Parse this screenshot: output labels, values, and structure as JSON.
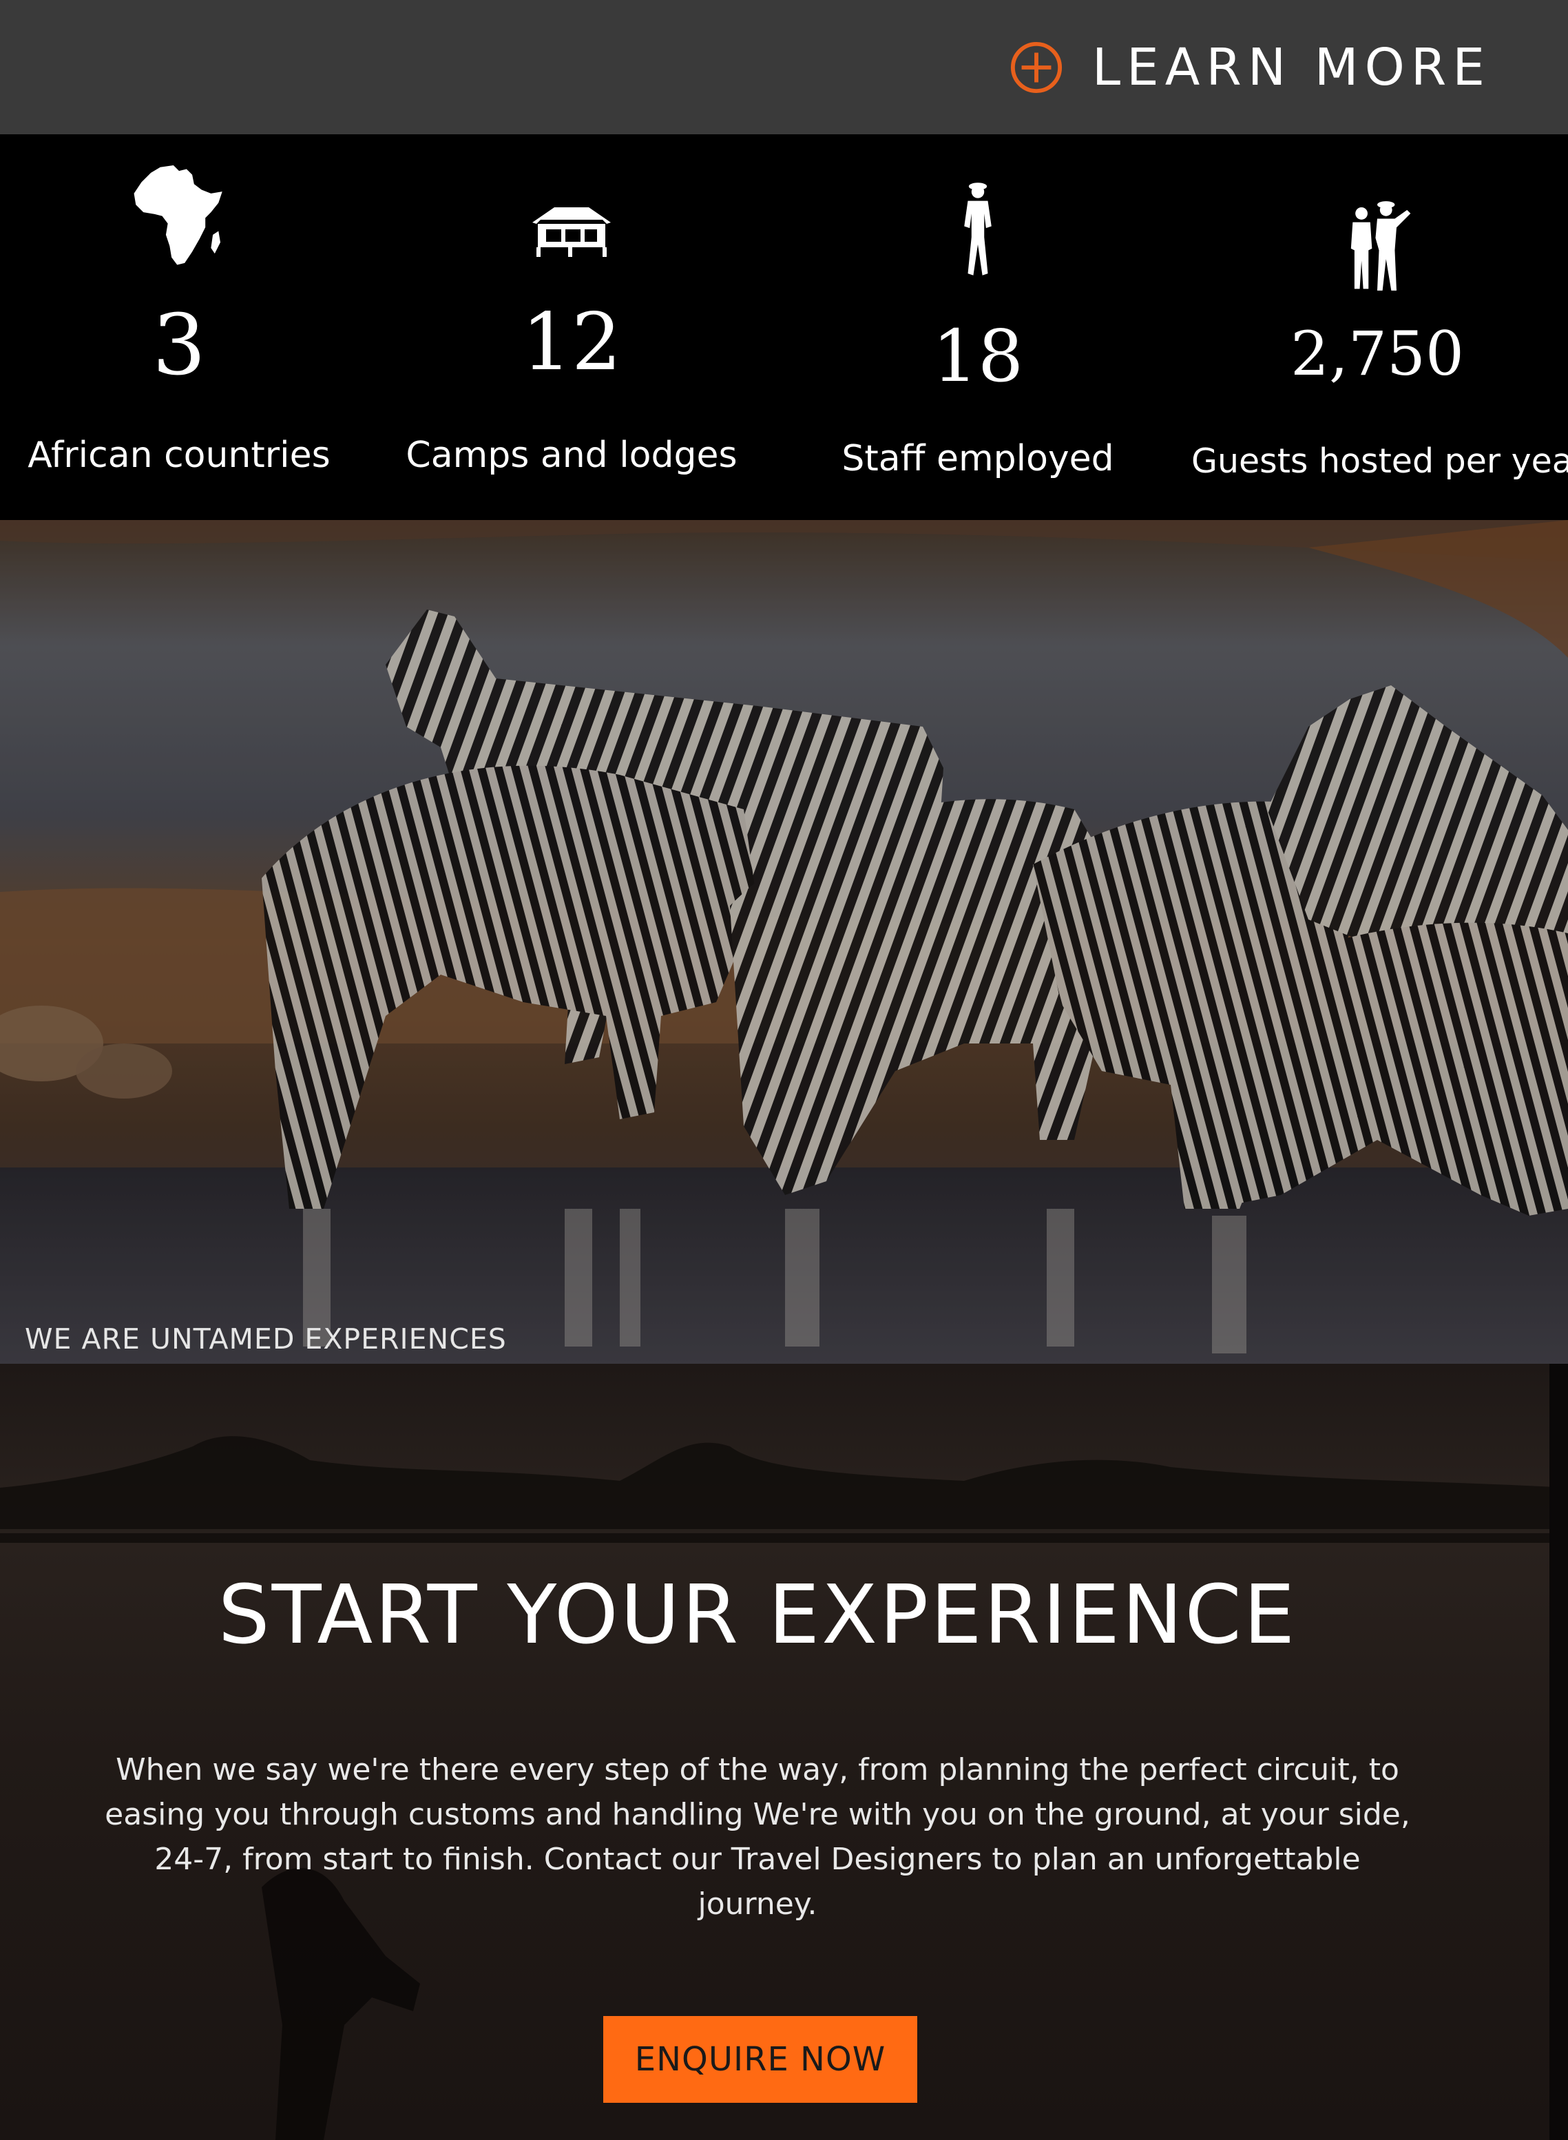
{
  "header": {
    "learn_more_label": "LEARN MORE",
    "icon": "plus-circle-icon",
    "accent_color": "#e8601c"
  },
  "stats": [
    {
      "icon": "africa-map-icon",
      "value": "3",
      "label": "African countries"
    },
    {
      "icon": "safari-tent-icon",
      "value": "12",
      "label": "Camps and lodges"
    },
    {
      "icon": "ranger-icon",
      "value": "18",
      "label": "Staff employed"
    },
    {
      "icon": "guests-icon",
      "value": "2,750",
      "label": "Guests hosted per year"
    }
  ],
  "hero": {
    "image": "zebras-drinking-photo",
    "caption": "WE ARE UNTAMED EXPERIENCES"
  },
  "cta": {
    "title": "START YOUR EXPERIENCE",
    "body": "When we say we're there every step of the way, from planning the perfect circuit, to easing you through customs and handling We're with you on the ground, at your side, 24-7, from start to finish. Contact our Travel Designers to plan an unforgettable journey.",
    "button_label": "ENQUIRE NOW",
    "button_color": "#ff6a13"
  }
}
